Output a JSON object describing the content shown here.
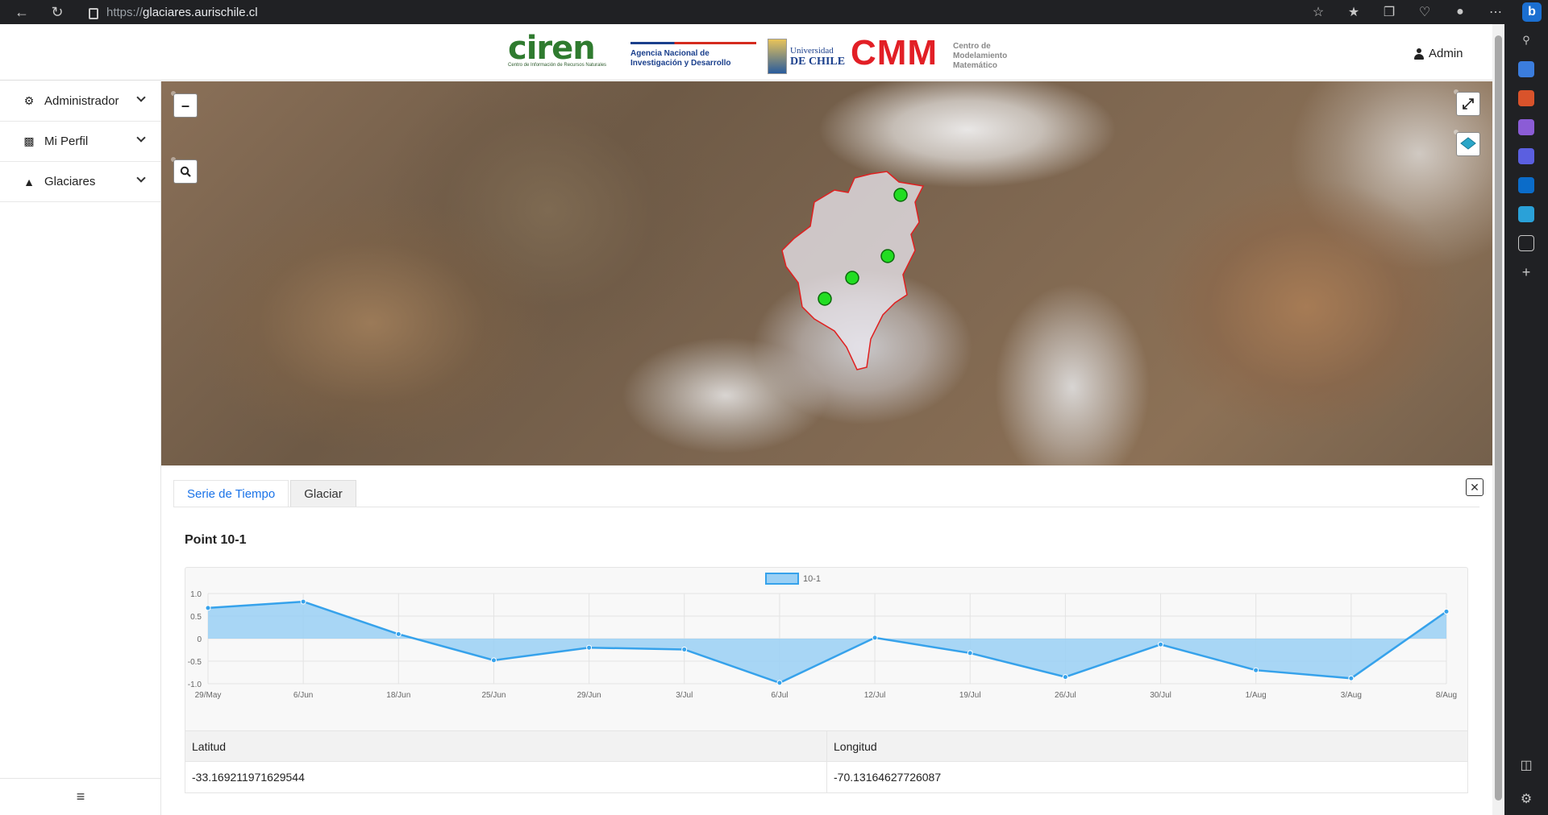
{
  "browser": {
    "url_scheme": "https://",
    "url_host": "glaciares.aurischile.cl"
  },
  "header": {
    "ciren_logo_text": "ciren",
    "ciren_subtitle": "Centro de Información de Recursos Naturales",
    "agencia_line1": "Agencia Nacional de",
    "agencia_line2": "Investigación y Desarrollo",
    "uchile_line1": "Universidad",
    "uchile_line2": "de Chile",
    "cmm_logo_text": "CMM",
    "cmm_line1": "Centro de",
    "cmm_line2": "Modelamiento",
    "cmm_line3": "Matemático",
    "user_label": "Admin"
  },
  "sidebar": {
    "items": [
      {
        "label": "Administrador",
        "icon": "users-cog-icon"
      },
      {
        "label": "Mi Perfil",
        "icon": "id-card-icon"
      },
      {
        "label": "Glaciares",
        "icon": "mountain-icon"
      }
    ]
  },
  "map": {
    "zoom_in": "+",
    "zoom_out": "–",
    "search": "search-icon",
    "fullscreen": "⤢",
    "layers": "layers-icon"
  },
  "panel": {
    "tabs": [
      {
        "label": "Serie de Tiempo",
        "active": true
      },
      {
        "label": "Glaciar",
        "active": false
      }
    ],
    "close": "✕",
    "point_title": "Point 10-1",
    "table": {
      "headers": [
        "Latitud",
        "Longitud"
      ],
      "values": [
        "-33.169211971629544",
        "-70.13164627726087"
      ]
    }
  },
  "colors": {
    "series_line": "#36a2eb",
    "series_fill": "#9ad0f5",
    "tab_active": "#1a73e8",
    "glacier_outline": "#e02020",
    "marker": "#22dd22"
  },
  "chart_data": {
    "type": "area",
    "categories": [
      "29/May",
      "6/Jun",
      "18/Jun",
      "25/Jun",
      "29/Jun",
      "3/Jul",
      "6/Jul",
      "12/Jul",
      "19/Jul",
      "26/Jul",
      "30/Jul",
      "1/Aug",
      "3/Aug",
      "8/Aug"
    ],
    "series": [
      {
        "name": "10-1",
        "values": [
          0.68,
          0.82,
          0.1,
          -0.48,
          -0.2,
          -0.24,
          -0.98,
          0.02,
          -0.32,
          -0.85,
          -0.13,
          -0.7,
          -0.88,
          0.6
        ]
      }
    ],
    "ylim": [
      -1.0,
      1.0
    ],
    "yticks": [
      "1.0",
      "0.5",
      "0",
      "-0.5",
      "-1.0"
    ],
    "legend_position": "top-center",
    "grid": true
  }
}
